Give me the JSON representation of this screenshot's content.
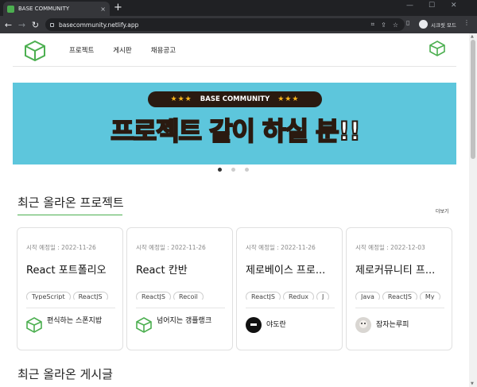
{
  "browser": {
    "tab_title": "BASE COMMUNITY",
    "tab_close": "×",
    "new_tab": "+",
    "url": "basecommunity.netlify.app",
    "incognito_label": "시크릿 모드",
    "win_min": "—",
    "win_max": "☐",
    "win_close": "✕"
  },
  "header": {
    "menu": [
      "프로젝트",
      "게시판",
      "채용공고"
    ]
  },
  "banner": {
    "pill_text": "BASE COMMUNITY",
    "stars": "★★★",
    "headline_highlight": "프로젝트",
    "headline_rest": "같이 하실 분!!"
  },
  "carousel": {
    "count": 3,
    "active": 0
  },
  "projects_section": {
    "title": "최근 올라온 프로젝트",
    "more": "더보기",
    "cards": [
      {
        "date": "시작 예정일 : 2022-11-26",
        "title": "React 포트폴리오",
        "tags": [
          "TypeScript",
          "ReactJS"
        ],
        "author": "편식하는 스폰지밥",
        "avatar": "cube-icon"
      },
      {
        "date": "시작 예정일 : 2022-11-26",
        "title": "React 칸반",
        "tags": [
          "ReactJS",
          "Recoil"
        ],
        "author": "넘어지는 갱플랭크",
        "avatar": "cube-icon"
      },
      {
        "date": "시작 예정일 : 2022-11-26",
        "title": "제로베이스 프로...",
        "tags": [
          "ReactJS",
          "Redux",
          "J"
        ],
        "author": "야도란",
        "avatar": "photo-dark"
      },
      {
        "date": "시작 예정일 : 2022-12-03",
        "title": "제로커뮤니티 프...",
        "tags": [
          "Java",
          "ReactJS",
          "My"
        ],
        "author": "잠자는루피",
        "avatar": "photo-light"
      }
    ]
  },
  "posts_section": {
    "title": "최근 올라온 게시글"
  },
  "colors": {
    "accent": "#4caf50",
    "banner_bg": "#5dc6dc",
    "banner_dark": "#2a1a10",
    "banner_yellow": "#f5b31d"
  }
}
